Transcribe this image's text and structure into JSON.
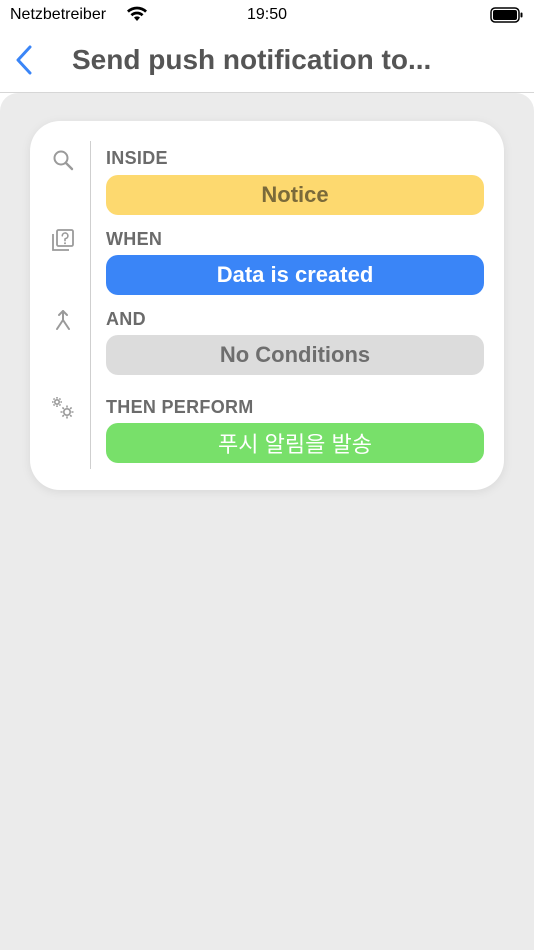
{
  "status_bar": {
    "carrier": "Netzbetreiber",
    "time": "19:50",
    "wifi_icon": "wifi-icon",
    "battery_icon": "battery-icon"
  },
  "nav": {
    "back_icon": "chevron-left-icon",
    "title": "Send push notification to..."
  },
  "colors": {
    "accent_blue": "#3a85f7",
    "inside_pill": "#fdd96f",
    "when_pill": "#3a85f7",
    "and_pill": "#dcdcdc",
    "then_pill": "#78e06a"
  },
  "steps": [
    {
      "label": "INSIDE",
      "value": "Notice",
      "icon": "search-icon"
    },
    {
      "label": "WHEN",
      "value": "Data is created",
      "icon": "question-card-icon"
    },
    {
      "label": "AND",
      "value": "No Conditions",
      "icon": "merge-arrow-icon"
    },
    {
      "label": "THEN PERFORM",
      "value": "푸시 알림을 발송",
      "icon": "gears-icon"
    }
  ]
}
